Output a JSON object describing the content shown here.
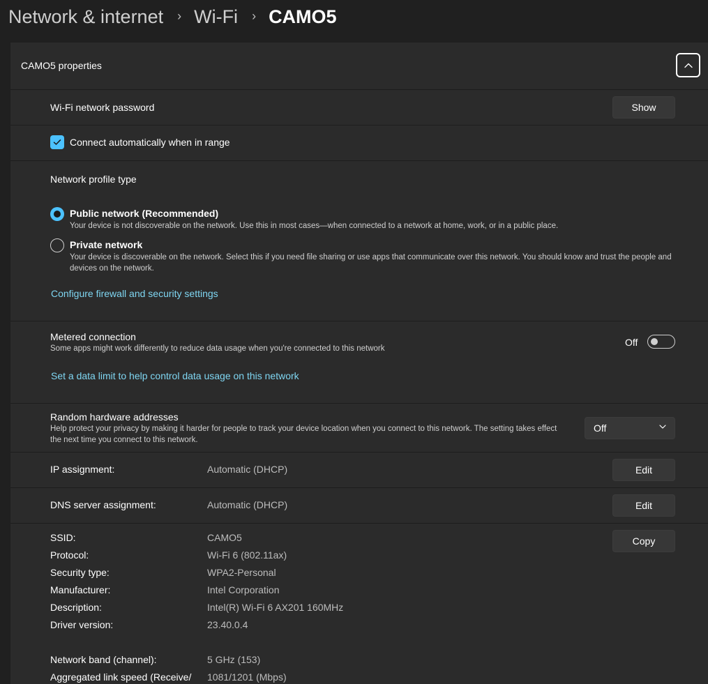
{
  "breadcrumb": {
    "items": [
      "Network & internet",
      "Wi-Fi"
    ],
    "current": "CAMO5",
    "separator": "›"
  },
  "panel": {
    "title": "CAMO5 properties"
  },
  "password": {
    "label": "Wi-Fi network password",
    "button": "Show"
  },
  "auto_connect": {
    "label": "Connect automatically when in range",
    "checked": true
  },
  "profile": {
    "heading": "Network profile type",
    "public": {
      "label": "Public network (Recommended)",
      "desc": "Your device is not discoverable on the network. Use this in most cases—when connected to a network at home, work, or in a public place.",
      "selected": true
    },
    "private": {
      "label": "Private network",
      "desc": "Your device is discoverable on the network. Select this if you need file sharing or use apps that communicate over this network. You should know and trust the people and devices on the network.",
      "selected": false
    },
    "firewall_link": "Configure firewall and security settings"
  },
  "metered": {
    "label": "Metered connection",
    "desc": "Some apps might work differently to reduce data usage when you're connected to this network",
    "state": "Off",
    "data_limit_link": "Set a data limit to help control data usage on this network"
  },
  "random_hw": {
    "label": "Random hardware addresses",
    "desc": "Help protect your privacy by making it harder for people to track your device location when you connect to this network. The setting takes effect the next time you connect to this network.",
    "value": "Off"
  },
  "ip": {
    "label": "IP assignment:",
    "value": "Automatic (DHCP)",
    "button": "Edit"
  },
  "dns": {
    "label": "DNS server assignment:",
    "value": "Automatic (DHCP)",
    "button": "Edit"
  },
  "details": {
    "copy_button": "Copy",
    "ssid_label": "SSID:",
    "ssid_value": "CAMO5",
    "protocol_label": "Protocol:",
    "protocol_value": "Wi-Fi 6 (802.11ax)",
    "security_label": "Security type:",
    "security_value": "WPA2-Personal",
    "manufacturer_label": "Manufacturer:",
    "manufacturer_value": "Intel Corporation",
    "description_label": "Description:",
    "description_value": "Intel(R) Wi-Fi 6 AX201 160MHz",
    "driver_label": "Driver version:",
    "driver_value": "23.40.0.4",
    "band_label": "Network band (channel):",
    "band_value": "5 GHz (153)",
    "speed_label": "Aggregated link speed (Receive/",
    "speed_value": "1081/1201 (Mbps)"
  },
  "colors": {
    "accent": "#4cc2ff",
    "link": "#7fd6f2",
    "background": "#202020",
    "card": "#2b2b2b"
  }
}
